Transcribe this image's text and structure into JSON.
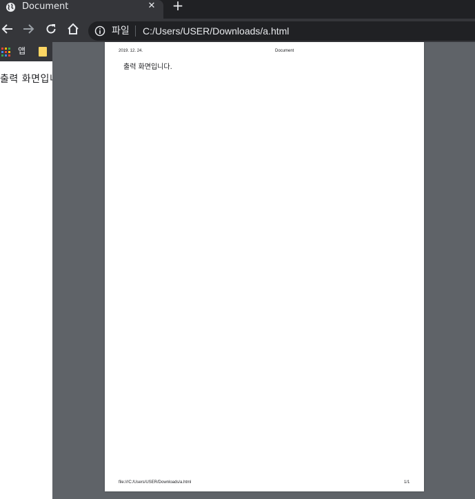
{
  "tab": {
    "title": "Document",
    "close_label": "✕",
    "new_tab_label": "+"
  },
  "toolbar": {
    "icons": [
      "back-arrow-icon",
      "forward-arrow-icon",
      "reload-icon",
      "home-icon",
      "info-icon"
    ],
    "file_chip": "파일",
    "url": "C:/Users/USER/Downloads/a.html"
  },
  "bookmarks": {
    "apps_label": "앱",
    "icons": [
      "apps-grid-icon",
      "bookmark-folder-icon"
    ]
  },
  "page": {
    "body_text": "출력 화면입니다."
  },
  "print_preview": {
    "header_date": "2019. 12. 24.",
    "header_title": "Document",
    "body_text": "출력 화면입니다.",
    "footer_url": "file:///C:/Users/USER/Downloads/a.html",
    "footer_page": "1/1"
  },
  "colors": {
    "tab_strip": "#202124",
    "toolbar": "#35363a",
    "preview_background": "#5f6368",
    "sheet": "#ffffff",
    "text_light": "#e8eaed"
  }
}
